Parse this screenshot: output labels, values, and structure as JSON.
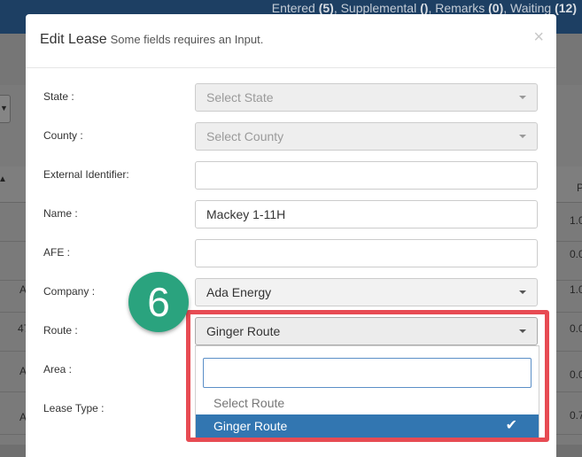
{
  "status_bar": {
    "entered_label": "Entered",
    "entered_count": "(5)",
    "supplemental_label": "Supplemental",
    "supplemental_count": "()",
    "remarks_label": "Remarks",
    "remarks_count": "(0)",
    "waiting_label": "Waiting",
    "waiting_count": "(12)"
  },
  "background_table": {
    "header_right": "P",
    "rows": [
      {
        "left": "",
        "right": "1.0"
      },
      {
        "left": "",
        "right": "0.0"
      },
      {
        "left": "A",
        "right": "1.0"
      },
      {
        "left": "47",
        "right": "0.0"
      },
      {
        "left": "A",
        "right": "0.0"
      },
      {
        "left": "A",
        "right": "0.0"
      },
      {
        "left": "A",
        "right": "0.7"
      }
    ]
  },
  "modal": {
    "title": "Edit Lease",
    "subtitle": "Some fields requires an Input.",
    "close_glyph": "×",
    "fields": {
      "state": {
        "label": "State :",
        "placeholder": "Select State"
      },
      "county": {
        "label": "County :",
        "placeholder": "Select County"
      },
      "external_identifier": {
        "label": "External Identifier:",
        "value": ""
      },
      "name": {
        "label": "Name :",
        "value": "Mackey 1-11H"
      },
      "afe": {
        "label": "AFE :",
        "value": ""
      },
      "company": {
        "label": "Company :",
        "value": "Ada Energy"
      },
      "route": {
        "label": "Route :",
        "value": "Ginger Route"
      },
      "area": {
        "label": "Area :"
      },
      "lease_type": {
        "label": "Lease Type :"
      }
    },
    "route_dropdown": {
      "search_value": "",
      "options": [
        {
          "label": "Select Route",
          "selected": false
        },
        {
          "label": "Ginger Route",
          "selected": true
        }
      ],
      "check_glyph": "✔"
    }
  },
  "annotation": {
    "step_number": "6",
    "badge_color": "#2aa37e",
    "highlight_color": "#e74b53"
  },
  "icons": {
    "select_caret": "caret-down-icon",
    "selected_check": "check-icon",
    "close": "close-icon"
  },
  "colors": {
    "topbar": "#1d3f63",
    "selected_option": "#3276b1",
    "search_border": "#5b8fc7"
  }
}
